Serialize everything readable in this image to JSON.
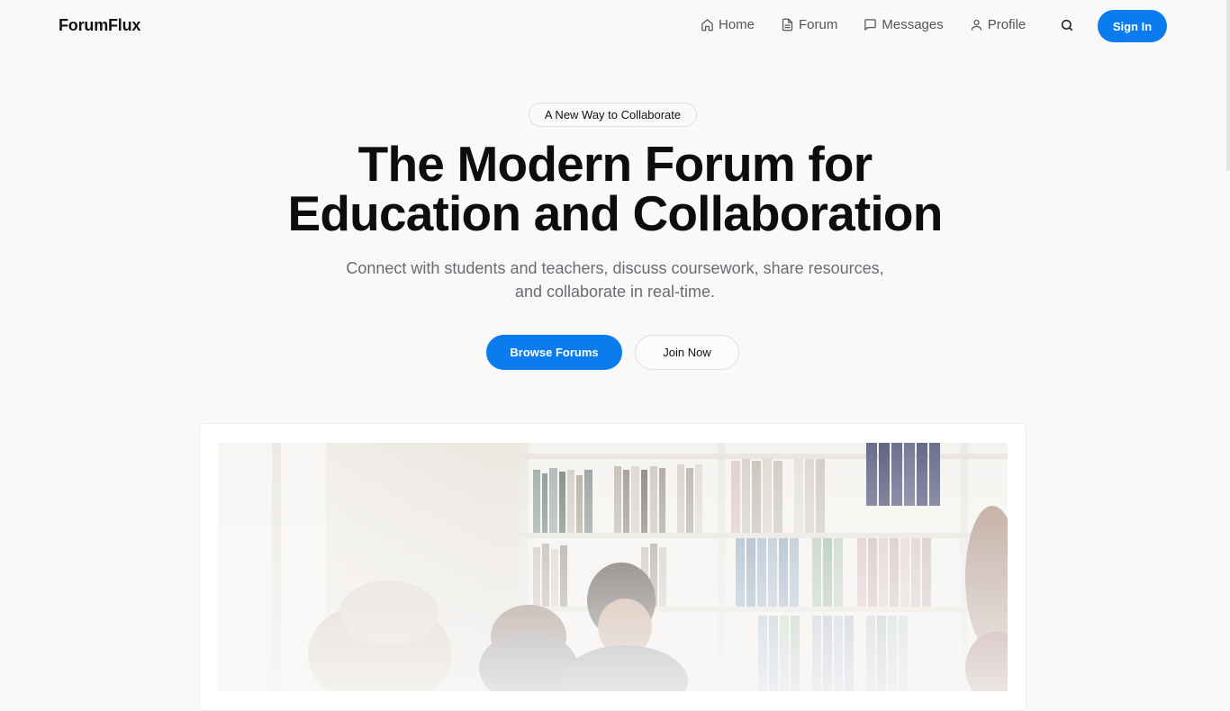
{
  "brand": "ForumFlux",
  "nav": {
    "items": [
      {
        "label": "Home",
        "icon": "home-icon"
      },
      {
        "label": "Forum",
        "icon": "document-icon"
      },
      {
        "label": "Messages",
        "icon": "message-icon"
      },
      {
        "label": "Profile",
        "icon": "user-icon"
      }
    ],
    "search_icon": "search-icon",
    "signin_label": "Sign In"
  },
  "hero": {
    "badge": "A New Way to Collaborate",
    "headline_line1": "The Modern Forum for",
    "headline_line2": "Education and Collaboration",
    "subtext": "Connect with students and teachers, discuss coursework, share resources, and collaborate in real-time.",
    "primary_button": "Browse Forums",
    "secondary_button": "Join Now"
  },
  "colors": {
    "accent": "#0a7cf0",
    "background": "#f9f9fa",
    "muted_text": "#6b6b72"
  }
}
